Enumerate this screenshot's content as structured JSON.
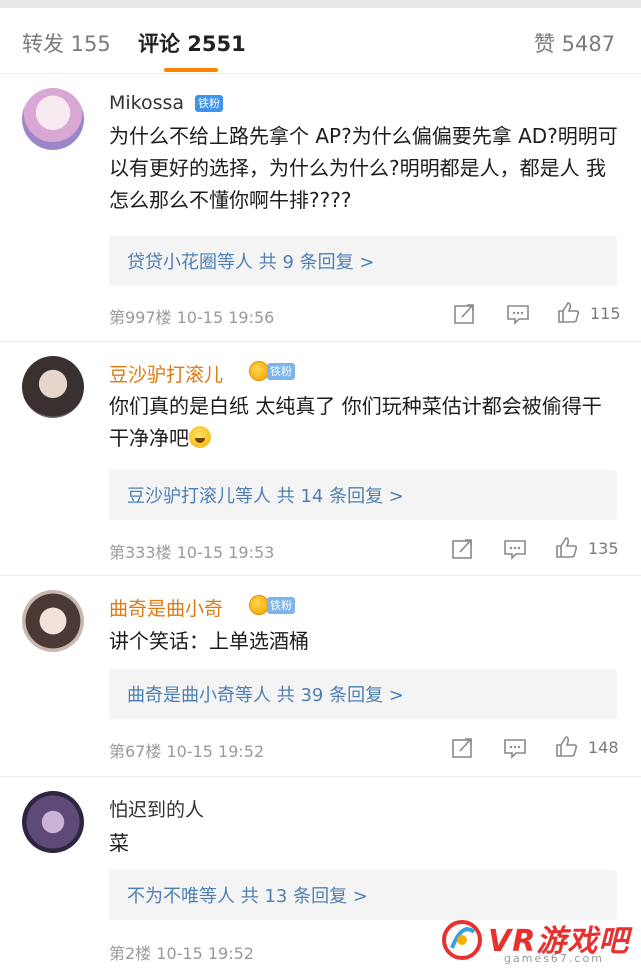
{
  "tabs": {
    "repost": "转发 155",
    "comments": "评论 2551",
    "likes": "赞 5487"
  },
  "comments": [
    {
      "user": "Mikossa",
      "badge": "铁粉",
      "text": "为什么不给上路先拿个 AP?为什么偏偏要先拿 AD?明明可以有更好的选择，为什么为什么?明明都是人，都是人 我怎么那么不懂你啊牛排????",
      "replies": "贷贷小花圈等人  共 9 条回复 >",
      "floor": "第997楼  10-15 19:56",
      "likes": "115"
    },
    {
      "user": "豆沙驴打滚儿",
      "badge": "铁粉",
      "text": "你们真的是白纸 太纯真了 你们玩种菜估计都会被偷得干干净净吧",
      "replies": "豆沙驴打滚儿等人  共 14 条回复 >",
      "floor": "第333楼  10-15 19:53",
      "likes": "135"
    },
    {
      "user": "曲奇是曲小奇",
      "badge": "铁粉",
      "text": "讲个笑话：上单选酒桶",
      "replies": "曲奇是曲小奇等人  共 39 条回复 >",
      "floor": "第67楼  10-15 19:52",
      "likes": "148"
    },
    {
      "user": "怕迟到的人",
      "text": "菜",
      "replies": "不为不唯等人  共 13 条回复 >",
      "floor": "第2楼  10-15 19:52"
    }
  ],
  "watermark": {
    "brand": "VR游戏吧",
    "domain": "games67.com"
  },
  "colors": {
    "accent": "#ff8200",
    "link": "#4f7fb2",
    "vip_name": "#e07a10",
    "badge_blue": "#3d94e8"
  }
}
